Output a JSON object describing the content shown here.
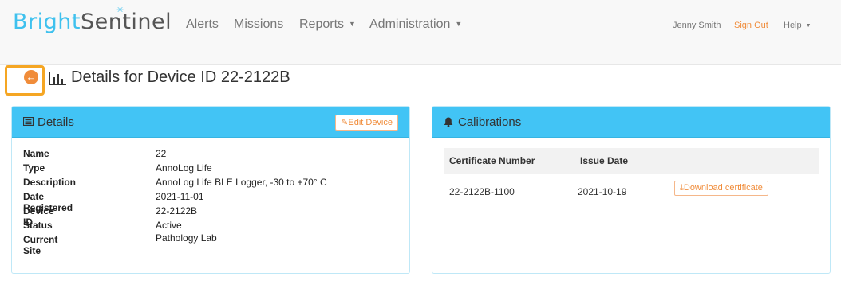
{
  "brand": {
    "part1": "Bright",
    "part2": "Sentinel"
  },
  "nav": {
    "items": [
      "Alerts",
      "Missions",
      "Reports",
      "Administration"
    ],
    "user": "Jenny Smith",
    "sign_out": "Sign Out",
    "help": "Help"
  },
  "page": {
    "title": "Details for Device ID 22-2122B"
  },
  "details": {
    "title": "Details",
    "edit_label": "Edit Device",
    "rows": [
      {
        "label": "Name",
        "value": "22"
      },
      {
        "label": "Type",
        "value": "AnnoLog Life"
      },
      {
        "label": "Description",
        "value": "AnnoLog Life BLE Logger, -30 to +70° C"
      },
      {
        "label": "Date Registered",
        "value": "2021-11-01"
      },
      {
        "label": "Device ID",
        "value": "22-2122B"
      },
      {
        "label": "Status",
        "value": "Active"
      },
      {
        "label": "Current Site",
        "value": "Pathology Lab"
      }
    ]
  },
  "calibrations": {
    "title": "Calibrations",
    "columns": [
      "Certificate Number",
      "Issue Date"
    ],
    "rows": [
      {
        "certificate": "22-2122B-1100",
        "issue_date": "2021-10-19",
        "action": "Download certificate"
      }
    ]
  },
  "colors": {
    "accent": "#42c4f5",
    "orange": "#f08c3a",
    "highlight": "#f5a623"
  }
}
